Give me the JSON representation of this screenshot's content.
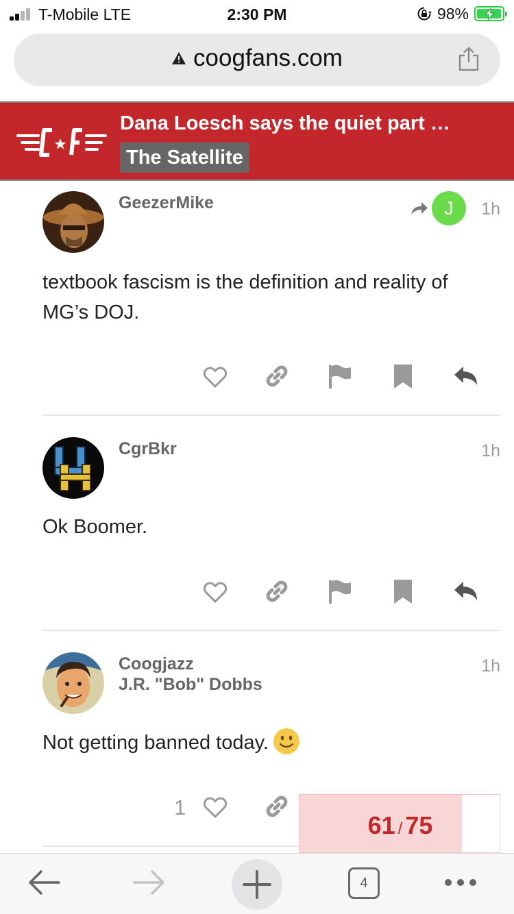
{
  "status_bar": {
    "carrier": "T-Mobile  LTE",
    "time": "2:30 PM",
    "battery": "98%",
    "battery_level": 0.98
  },
  "browser": {
    "url": "coogfans.com"
  },
  "banner": {
    "title": "Dana Loesch says the quiet part …",
    "category": "The Satellite",
    "background": "#c4272b"
  },
  "posts": [
    {
      "username": "GeezerMike",
      "time": "1h",
      "reply_to_avatar_letter": "J",
      "body": [
        "textbook fascism is the definition and reality of",
        "MG’s DOJ."
      ]
    },
    {
      "username": "CgrBkr",
      "time": "1h",
      "body": [
        "Ok Boomer."
      ]
    },
    {
      "username": "Coogjazz",
      "user_title": "J.R. \"Bob\" Dobbs",
      "time": "1h",
      "body": [
        "Not getting banned today."
      ],
      "like_count": "1"
    }
  ],
  "progress": {
    "current": "61",
    "separator": "/",
    "total": "75",
    "fraction": 0.813
  },
  "toolbar": {
    "tab_count": "4"
  },
  "icons": [
    "signal-icon",
    "orientation-lock-icon",
    "battery-icon",
    "warning-icon",
    "share-icon",
    "site-logo",
    "heart-icon",
    "link-icon",
    "flag-icon",
    "bookmark-icon",
    "reply-icon",
    "back-icon",
    "forward-icon",
    "plus-icon",
    "tabs-icon",
    "more-icon",
    "smile-emoji"
  ],
  "colors": {
    "accent_red": "#c0282a",
    "action_gray": "#9a9a9a",
    "reply_avatar_green": "#6adc4c"
  }
}
